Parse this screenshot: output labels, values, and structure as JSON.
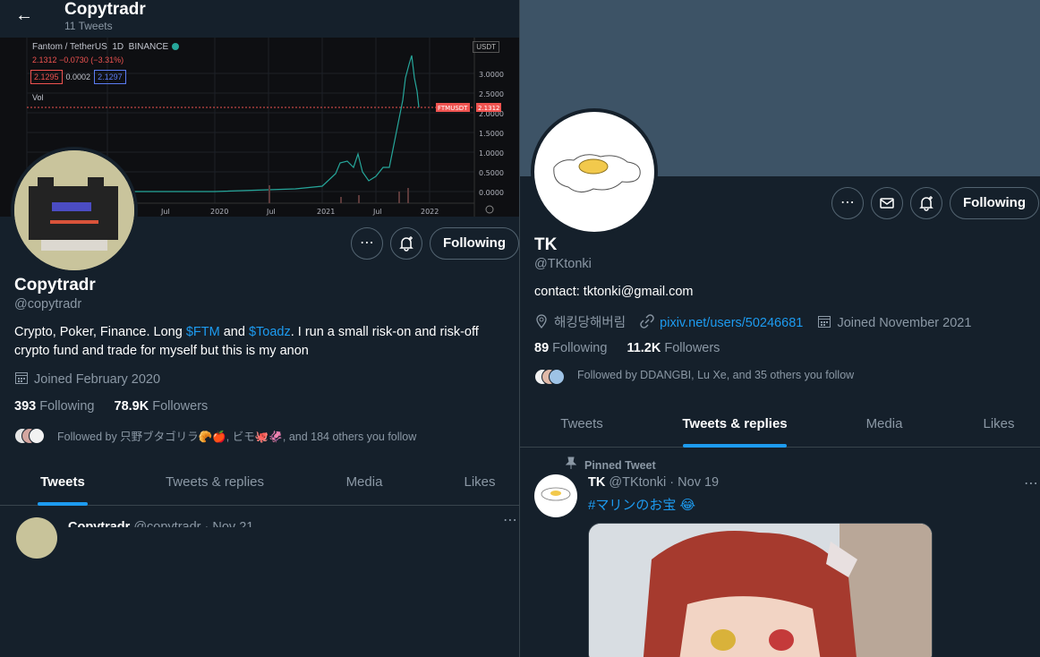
{
  "left": {
    "header": {
      "name": "Copytradr",
      "tweet_count": "11 Tweets"
    },
    "banner": {
      "pair": "Fantom / TetherUS",
      "interval": "1D",
      "exchange": "BINANCE",
      "price_line": "2.1312 −0.0730 (−3.31%)",
      "bid": "2.1295",
      "spread": "0.0002",
      "ask": "2.1297",
      "vol_label": "Vol",
      "currency": "USDT",
      "symbol_tag": "FTMUSDT",
      "symbol_price": "2.1312",
      "y_ticks": [
        "3.0000",
        "2.5000",
        "2.0000",
        "1.5000",
        "1.0000",
        "0.5000",
        "0.0000"
      ],
      "x_ticks": [
        "Jul",
        "2020",
        "Jul",
        "2021",
        "Jul",
        "2022"
      ]
    },
    "profile": {
      "name": "Copytradr",
      "handle": "@copytradr",
      "bio_prefix": "Crypto, Poker, Finance.  Long ",
      "bio_link1": "$FTM",
      "bio_mid": " and ",
      "bio_link2": "$Toadz",
      "bio_suffix": ".  I run a small risk-on and risk-off crypto fund and trade for myself but this is my anon",
      "joined": "Joined February 2020",
      "following_count": "393",
      "following_label": "Following",
      "followers_count": "78.9K",
      "followers_label": "Followers",
      "followed_by": "Followed by 只野ブタゴリラ🥐🍎, ビモ🐙🦑, and 184 others you follow",
      "follow_button": "Following"
    },
    "tabs": [
      "Tweets",
      "Tweets & replies",
      "Media",
      "Likes"
    ],
    "tweet_preview": {
      "name": "Copytradr",
      "handle": "@copytradr",
      "date": "· Nov 21"
    }
  },
  "right": {
    "profile": {
      "name": "TK",
      "handle": "@TKtonki",
      "bio": "contact: tktonki@gmail.com",
      "location": "해킹당해버림",
      "website": "pixiv.net/users/50246681",
      "joined": "Joined November 2021",
      "following_count": "89",
      "following_label": "Following",
      "followers_count": "11.2K",
      "followers_label": "Followers",
      "followed_by": "Followed by DDANGBI, Lu Xe, and 35 others you follow",
      "follow_button": "Following"
    },
    "tabs": [
      "Tweets",
      "Tweets & replies",
      "Media",
      "Likes"
    ],
    "pinned": {
      "label": "Pinned Tweet",
      "name": "TK",
      "handle": "@TKtonki",
      "date": "· Nov 19",
      "text": "#マリンのお宝 😂"
    }
  },
  "colors": {
    "background": "#15202b",
    "accent": "#1d9bf0",
    "muted": "#8b98a5",
    "banner_right": "#3d5366"
  },
  "icons": [
    "back-arrow-icon",
    "more-icon",
    "bell-plus-icon",
    "mail-icon",
    "calendar-icon",
    "location-icon",
    "link-icon",
    "pin-icon"
  ]
}
